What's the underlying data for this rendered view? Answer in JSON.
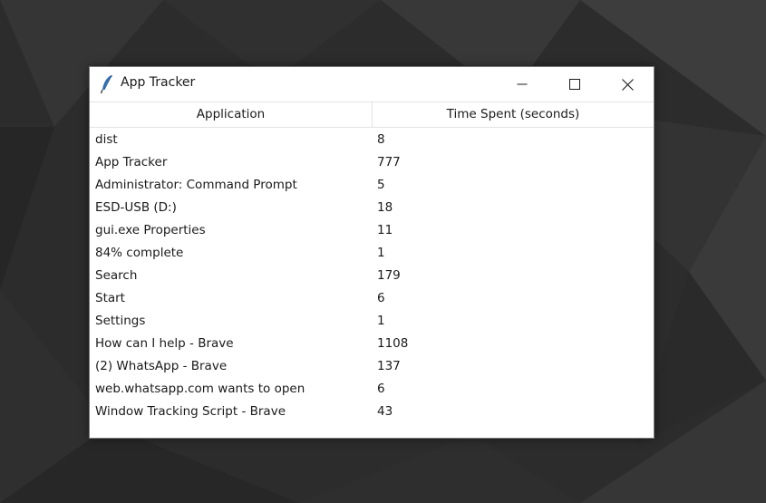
{
  "window": {
    "title": "App Tracker",
    "title_icon": "feather-icon",
    "controls": {
      "minimize_icon": "minimize-icon",
      "maximize_icon": "maximize-icon",
      "close_icon": "close-icon"
    }
  },
  "table": {
    "columns": [
      "Application",
      "Time Spent (seconds)"
    ],
    "rows": [
      {
        "application": "dist",
        "time": "8"
      },
      {
        "application": "App Tracker",
        "time": "777"
      },
      {
        "application": "Administrator: Command Prompt",
        "time": "5"
      },
      {
        "application": "ESD-USB (D:)",
        "time": "18"
      },
      {
        "application": "gui.exe Properties",
        "time": "11"
      },
      {
        "application": "84% complete",
        "time": "1"
      },
      {
        "application": "Search",
        "time": "179"
      },
      {
        "application": "Start",
        "time": "6"
      },
      {
        "application": "Settings",
        "time": "1"
      },
      {
        "application": "How can I help - Brave",
        "time": "1108"
      },
      {
        "application": "(2) WhatsApp - Brave",
        "time": "137"
      },
      {
        "application": "web.whatsapp.com wants to open",
        "time": "6"
      },
      {
        "application": "Window Tracking Script - Brave",
        "time": "43"
      }
    ]
  },
  "colors": {
    "desktop_background": "#2b2b2b",
    "window_background": "#ffffff",
    "text": "#1a1a1a",
    "feather_icon": "#2f6fb0"
  }
}
